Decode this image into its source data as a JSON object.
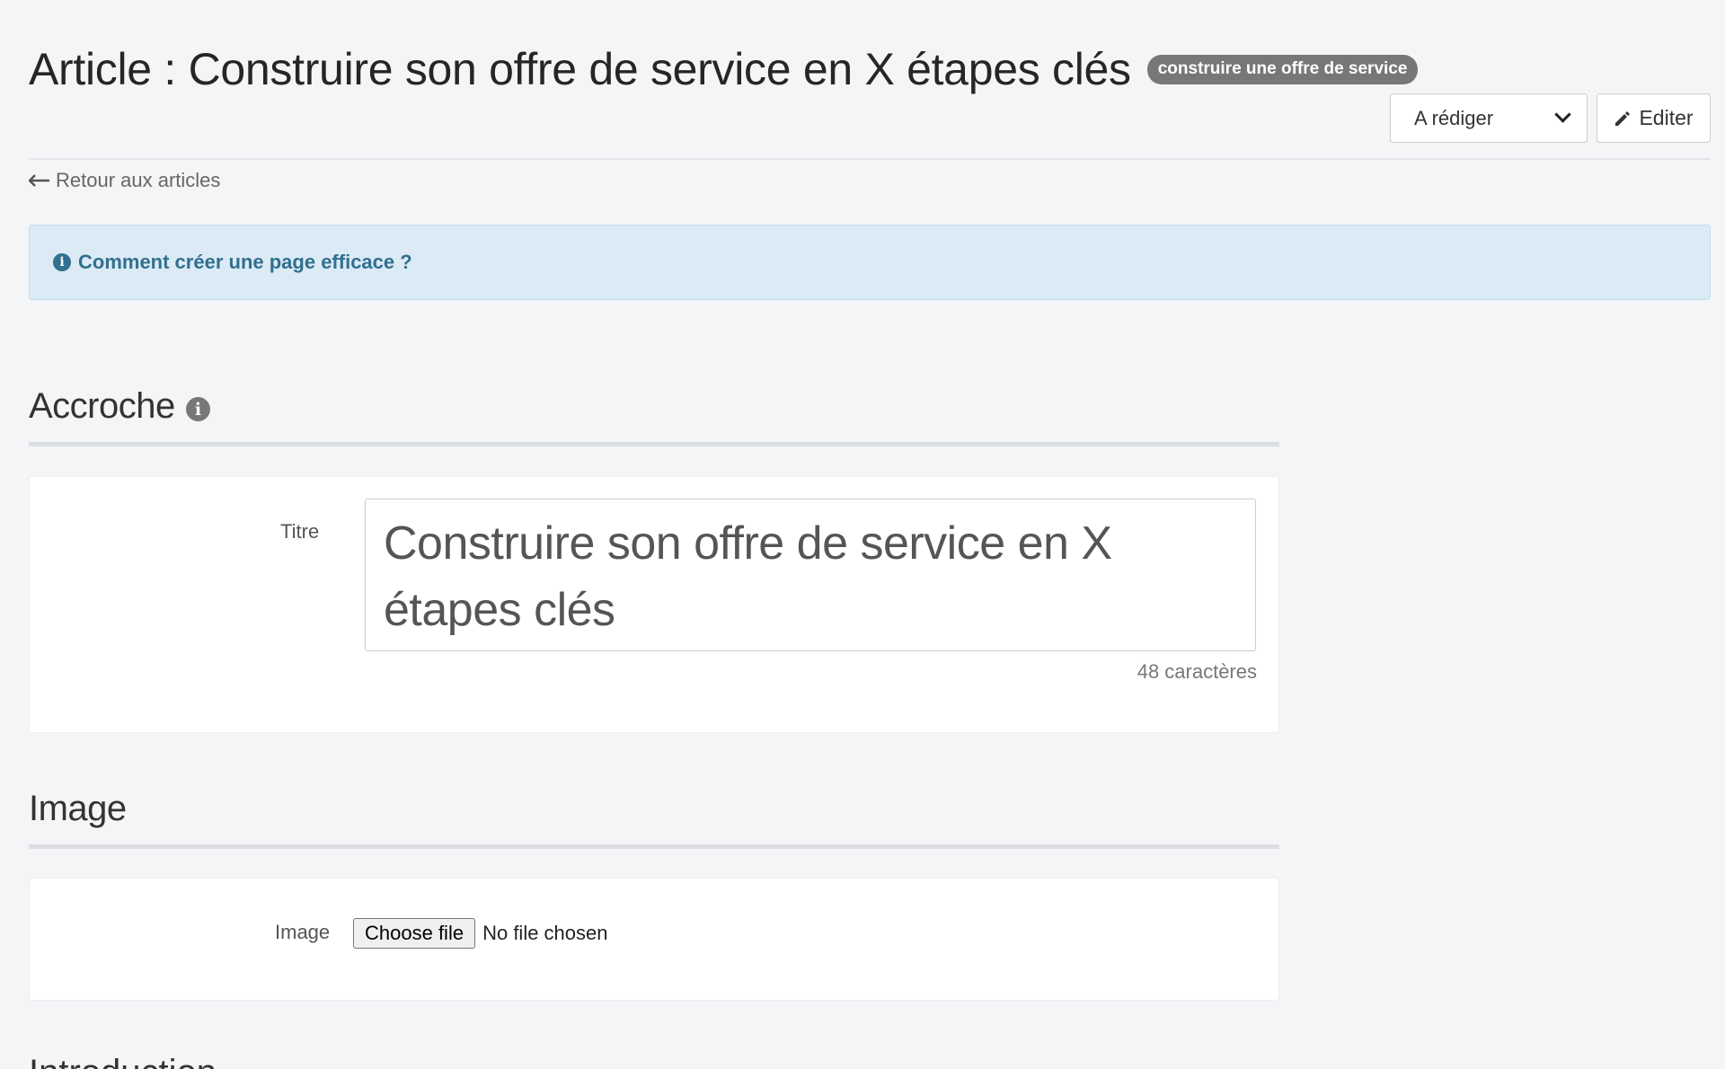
{
  "header": {
    "title": "Article : Construire son offre de service en X étapes clés",
    "badge": "construire une offre de service",
    "status_select": "A rédiger",
    "edit_label": "Editer"
  },
  "nav": {
    "back_label": "Retour aux articles"
  },
  "info_alert": {
    "text": "Comment créer une page efficace ?"
  },
  "sections": {
    "accroche": {
      "title": "Accroche",
      "title_label": "Titre",
      "title_value": "Construire son offre de service en X étapes clés",
      "char_count": "48 caractères"
    },
    "image": {
      "title": "Image",
      "field_label": "Image",
      "choose_label": "Choose file",
      "file_status": "No file chosen"
    },
    "introduction": {
      "title": "Introduction"
    }
  },
  "colors": {
    "background": "#f4f5f7",
    "info_bg": "#dbeaf5",
    "info_text": "#31708f",
    "badge_bg": "#777777"
  },
  "icons": [
    "pencil-icon",
    "arrow-left-icon",
    "info-circle-icon"
  ]
}
